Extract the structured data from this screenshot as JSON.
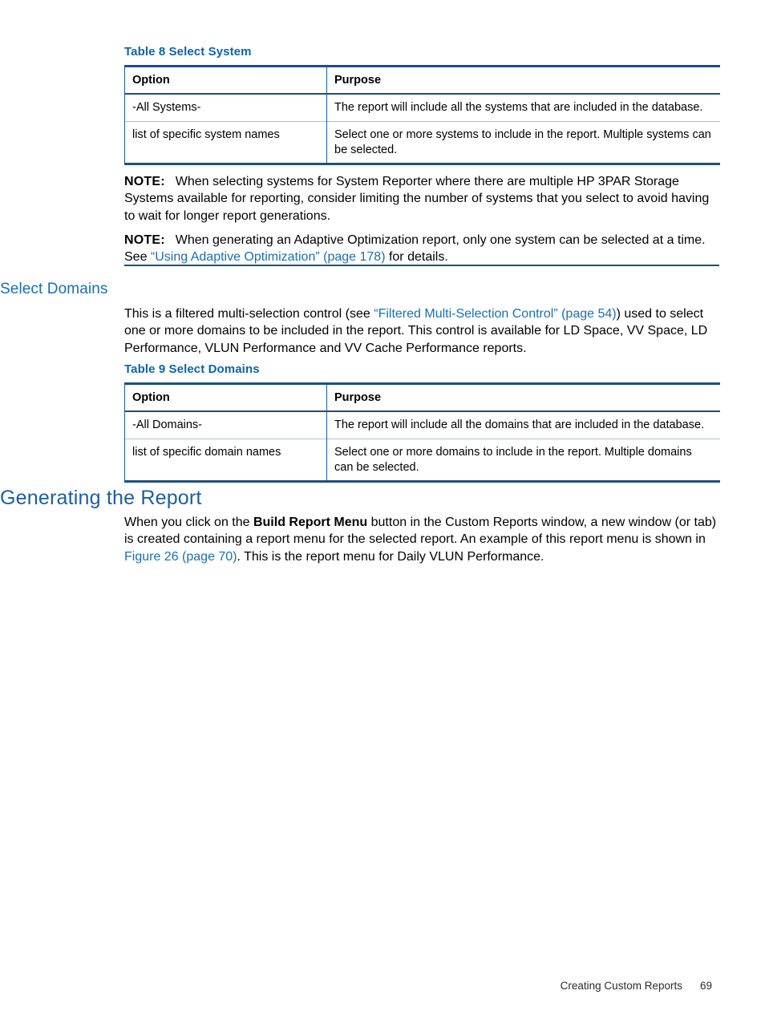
{
  "page": {
    "footer_section": "Creating Custom Reports",
    "footer_page_number": "69"
  },
  "colors": {
    "heading_blue": "#1b5fa0",
    "subheading_blue": "#1b6eb3",
    "caption_blue": "#0f62a8",
    "link_blue": "#1b6eb3",
    "table_border_dark": "#1a4f86",
    "table_border_light": "#a9c4de",
    "body_text": "#000000"
  },
  "table8": {
    "caption": "Table 8 Select System",
    "headers": [
      "Option",
      "Purpose"
    ],
    "rows": [
      {
        "option": "-All Systems-",
        "purpose": "The report will include all the systems that are included in the database."
      },
      {
        "option": "list of specific system names",
        "purpose": "Select one or more systems to include in the report. Multiple systems can be selected."
      }
    ]
  },
  "notes": [
    {
      "label": "NOTE:",
      "text": "When selecting systems for System Reporter where there are multiple HP 3PAR Storage Systems available for reporting, consider limiting the number of systems that you select to avoid having to wait for longer report generations."
    },
    {
      "label": "NOTE:",
      "text_before_link": "When generating an Adaptive Optimization report, only one system can be selected at a time. See ",
      "link": "“Using Adaptive Optimization” (page 178)",
      "text_after_link": " for details."
    }
  ],
  "select_domains": {
    "heading": "Select Domains",
    "paragraph": {
      "part1": "This is a filtered multi-selection control (see ",
      "link": "“Filtered Multi-Selection Control” (page 54)",
      "part2": ") used to select one or more domains to be included in the report. This control is available for LD Space, VV Space, LD Performance, VLUN Performance and VV Cache Performance reports."
    }
  },
  "table9": {
    "caption": "Table 9 Select Domains",
    "headers": [
      "Option",
      "Purpose"
    ],
    "rows": [
      {
        "option": "-All Domains-",
        "purpose": "The report will include all the domains that are included in the database."
      },
      {
        "option": "list of specific domain names",
        "purpose": "Select one or more domains to include in the report. Multiple domains can be selected."
      }
    ]
  },
  "generating_the_report": {
    "heading": "Generating the Report",
    "paragraph": {
      "part1": "When you click on the ",
      "bold": "Build Report Menu",
      "part2": " button in the Custom Reports window, a new window (or tab) is created containing a report menu for the selected report. An example of this report menu is shown in ",
      "link": "Figure 26 (page 70)",
      "part3": ". This is the report menu for Daily VLUN Performance."
    }
  }
}
